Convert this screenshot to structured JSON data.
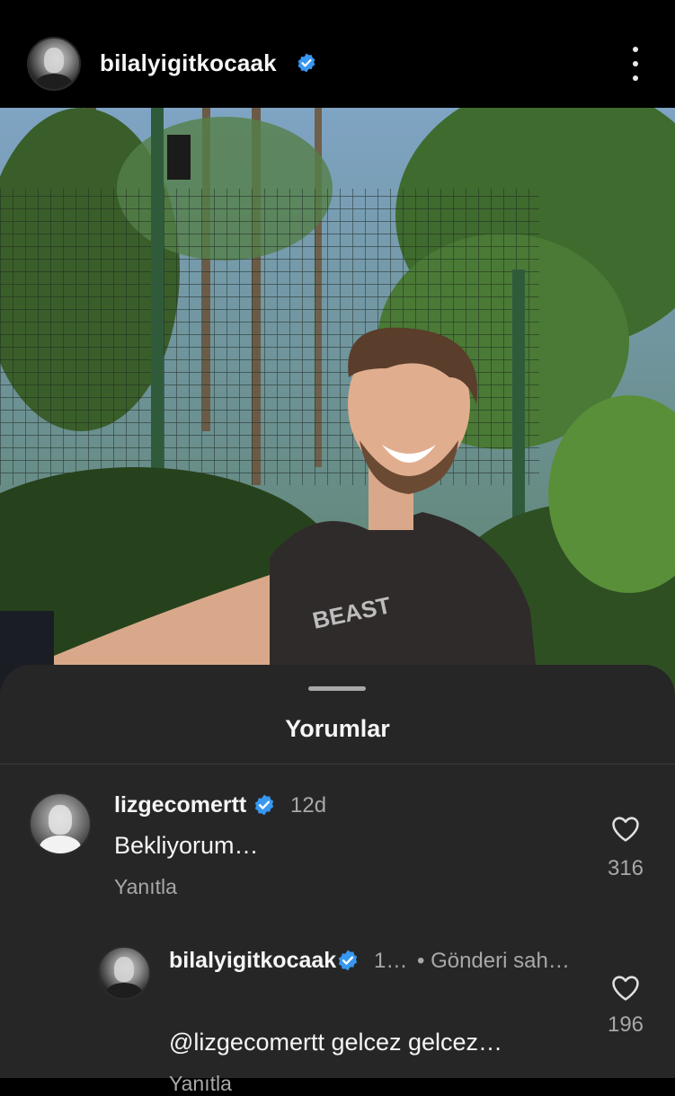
{
  "header": {
    "username": "bilalyigitkocaak",
    "verified_icon": "verified-badge-icon",
    "more_icon": "more-options-icon"
  },
  "post": {
    "image_description_icon": "post-photo"
  },
  "comments_sheet": {
    "title": "Yorumlar",
    "comments": [
      {
        "username": "lizgecomertt",
        "time": "12d",
        "text": "Bekliyorum…",
        "reply_label": "Yanıtla",
        "like_count": "316"
      },
      {
        "username": "bilalyigitkocaak",
        "time": "1…",
        "badge": "• Gönderi sah…",
        "text": "@lizgecomertt gelcez gelcez…",
        "reply_label": "Yanıtla",
        "like_count": "196"
      }
    ]
  },
  "colors": {
    "background": "#000000",
    "sheet": "#262626",
    "verified_blue": "#3897f0",
    "secondary_text": "#a8a8a8"
  }
}
